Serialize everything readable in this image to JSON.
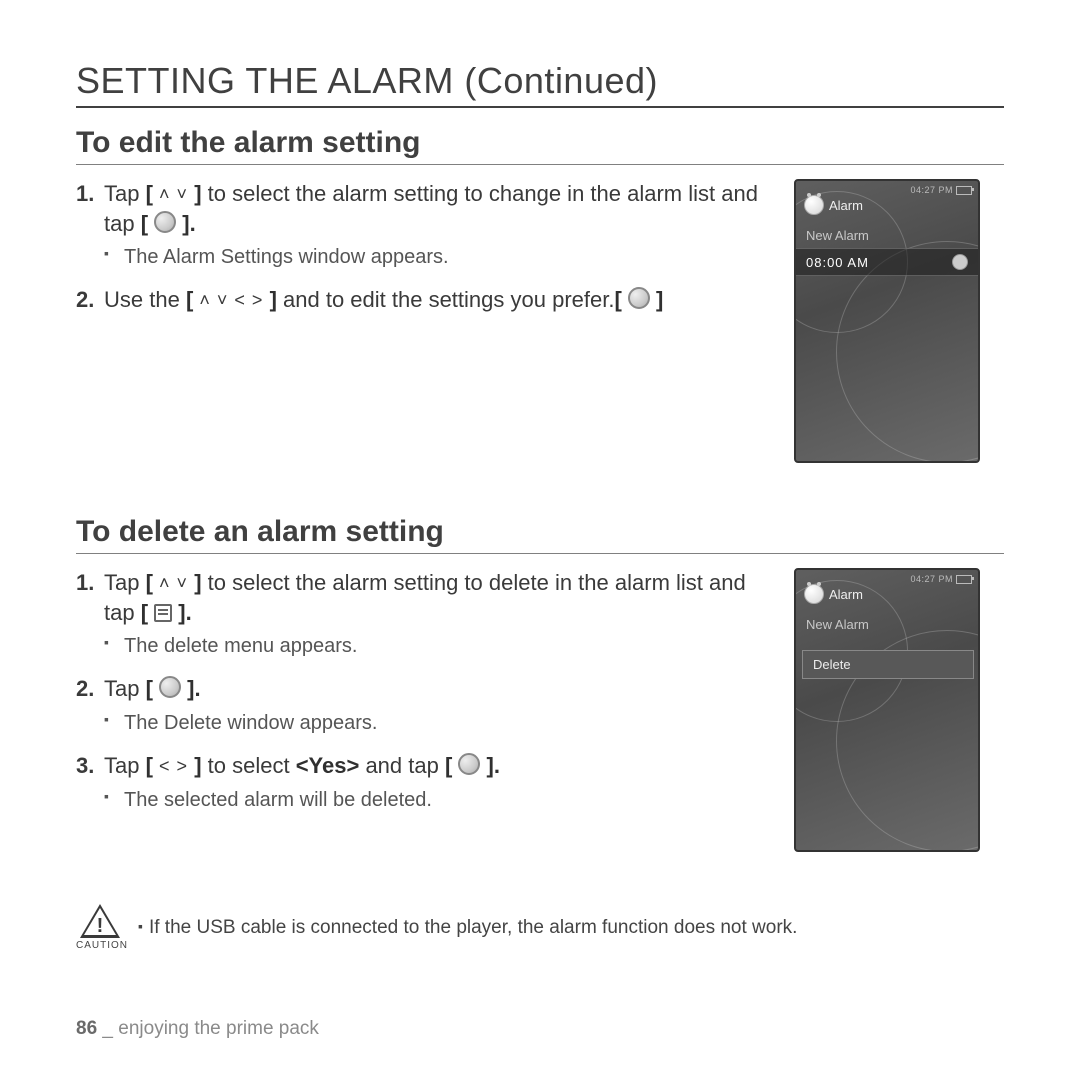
{
  "page": {
    "title": "SETTING THE ALARM (Continued)",
    "section_edit": {
      "heading": "To edit the alarm setting",
      "steps": [
        {
          "num": "1.",
          "pre": "Tap ",
          "icons1": "[",
          "icons1_glyph": "up_down",
          "icons1_end": "]",
          "mid": " to select the alarm setting to change in the alarm list and tap ",
          "icons2": "[",
          "icons2_glyph": "circle",
          "icons2_end": "].",
          "sub": "The Alarm Settings window appears."
        },
        {
          "num": "2.",
          "pre": "Use the ",
          "icons1": "[",
          "icons1_glyph": "all_dirs",
          "icons1_end": "]",
          "mid": " and ",
          "icons2": "[",
          "icons2_glyph": "circle",
          "icons2_end": "]",
          "post": " to edit the settings you prefer."
        }
      ]
    },
    "section_delete": {
      "heading": "To delete an alarm setting",
      "steps": [
        {
          "num": "1.",
          "pre": "Tap ",
          "icons1": "[",
          "icons1_glyph": "up_down",
          "icons1_end": "]",
          "mid": " to select the alarm setting to delete in the alarm list and tap ",
          "icons2": "[",
          "icons2_glyph": "menu",
          "icons2_end": "].",
          "sub": "The delete menu appears."
        },
        {
          "num": "2.",
          "pre": "Tap ",
          "icons1": "[",
          "icons1_glyph": "circle",
          "icons1_end": "].",
          "sub": "The Delete window appears."
        },
        {
          "num": "3.",
          "pre": "Tap ",
          "icons1": "[",
          "icons1_glyph": "left_right",
          "icons1_end": "]",
          "mid": " to select ",
          "bold": "<Yes>",
          "post": " and tap ",
          "icons2": "[",
          "icons2_glyph": "circle",
          "icons2_end": "].",
          "sub": "The selected alarm will be deleted."
        }
      ]
    },
    "caution": {
      "label": "CAUTION",
      "text": "If the USB cable is connected to the player, the alarm function does not work."
    },
    "footer": {
      "page_no": "86",
      "sep": " _ ",
      "chapter": "enjoying the prime pack"
    }
  },
  "device_edit": {
    "status_time": "04:27 PM",
    "title": "Alarm",
    "rows": [
      {
        "label": "New Alarm",
        "selected": false
      },
      {
        "label": "08:00 AM",
        "selected": true
      }
    ]
  },
  "device_delete": {
    "status_time": "04:27 PM",
    "title": "Alarm",
    "rows": [
      {
        "label": "New Alarm",
        "selected": false
      }
    ],
    "popup": "Delete"
  },
  "glyph_map": {
    "up_down": "˄  ˅",
    "all_dirs": "˄  ˅  ˂  ˃",
    "left_right": "˂  ˃"
  }
}
